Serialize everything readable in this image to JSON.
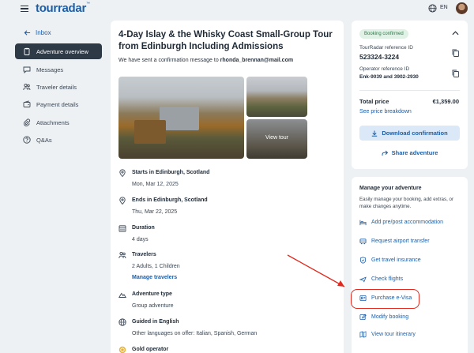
{
  "header": {
    "logo": "tourradar",
    "lang": "EN"
  },
  "sidebar": {
    "inbox": "Inbox",
    "items": [
      {
        "label": "Adventure overview"
      },
      {
        "label": "Messages"
      },
      {
        "label": "Traveler details"
      },
      {
        "label": "Payment details"
      },
      {
        "label": "Attachments"
      },
      {
        "label": "Q&As"
      }
    ]
  },
  "tour": {
    "title": "4-Day Islay & the Whisky Coast Small-Group Tour from Edinburgh Including Admissions",
    "confirm_prefix": "We have sent a confirmation message to ",
    "email": "rhonda_brennan@mail.com",
    "view_tour": "View tour",
    "details": [
      {
        "label": "Starts in Edinburgh, Scotland",
        "value": "Mon, Mar 12, 2025"
      },
      {
        "label": "Ends in Edinburgh, Scotland",
        "value": "Thu, Mar 22, 2025"
      },
      {
        "label": "Duration",
        "value": "4 days"
      },
      {
        "label": "Travelers",
        "value": "2 Adults, 1 Children",
        "link": "Manage travelers"
      },
      {
        "label": "Adventure type",
        "value": "Group adventure"
      },
      {
        "label": "Guided in English",
        "value": "Other languages on offer: Italian, Spanish, German"
      },
      {
        "label": "Gold operator"
      }
    ]
  },
  "booking": {
    "status": "Booking confirmed",
    "ref_label": "TourRadar reference ID",
    "ref_value": "523324-3224",
    "op_label": "Operator reference ID",
    "op_value": "Enk-9039 and 3902-2930",
    "total_label": "Total price",
    "total_value": "€1,359.00",
    "breakdown": "See price breakdown",
    "download": "Download confirmation",
    "share": "Share adventure"
  },
  "manage": {
    "title": "Manage your adventure",
    "desc": "Easily manage your booking, add extras, or make changes anytime.",
    "actions": [
      {
        "label": "Add pre/post accommodation",
        "icon": "bed-icon"
      },
      {
        "label": "Request airport transfer",
        "icon": "bus-icon"
      },
      {
        "label": "Get travel insurance",
        "icon": "shield-icon"
      },
      {
        "label": "Check flights",
        "icon": "plane-icon"
      },
      {
        "label": "Purchase e-Visa",
        "icon": "visa-icon"
      },
      {
        "label": "Modify booking",
        "icon": "edit-icon"
      },
      {
        "label": "View tour itinerary",
        "icon": "itinerary-icon"
      }
    ]
  },
  "colors": {
    "accent": "#1d5fa7",
    "highlight": "#e02a1f",
    "active_nav": "#2f3a47"
  }
}
